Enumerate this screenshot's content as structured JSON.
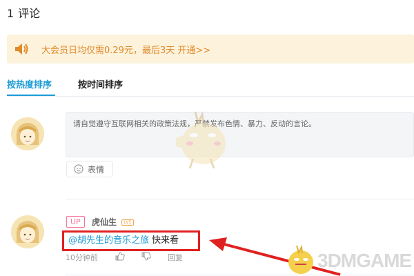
{
  "header": {
    "count": "1",
    "title": "评论"
  },
  "banner": {
    "text": "大会员日均仅需0.29元，最后3天 开通>>",
    "color": "#e08a2a"
  },
  "tabs": [
    {
      "label": "按热度排序",
      "active": true
    },
    {
      "label": "按时间排序",
      "active": false
    }
  ],
  "compose": {
    "placeholder": "请自觉遵守互联网相关的政策法规，严禁发布色情、暴力、反动的言论。",
    "emoji_label": "表情"
  },
  "comment": {
    "up_tag": "UP",
    "username": "虎仙生",
    "level_badge": "LV5",
    "mention": "@胡先生的音乐之旅",
    "text": "快来看",
    "time": "10分钟前",
    "reply_label": "回复"
  },
  "watermark": {
    "text": "3DMGAME"
  },
  "colors": {
    "accent": "#1a9ad6",
    "highlight_box": "#e02020",
    "up_tag": "#fb7299"
  }
}
